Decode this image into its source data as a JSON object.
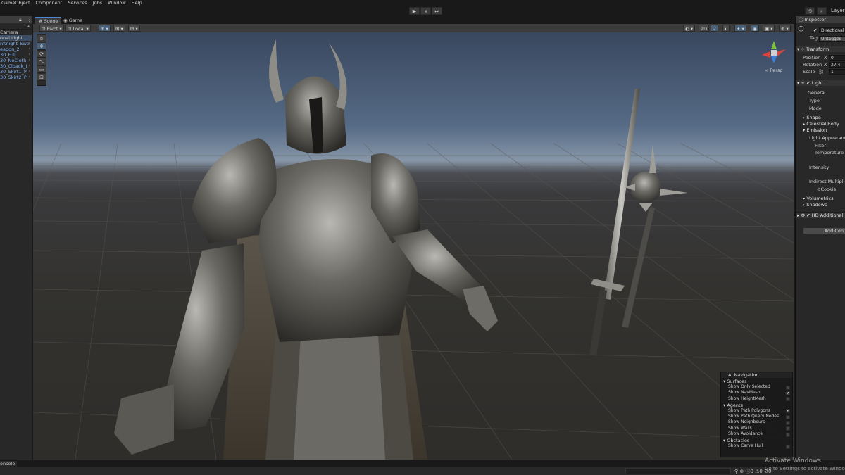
{
  "menu": [
    "GameObject",
    "Component",
    "Services",
    "Jobs",
    "Window",
    "Help"
  ],
  "toolbar": {
    "play": "▶",
    "pause": "⏸",
    "step": "⏭",
    "layers": "Layers"
  },
  "hierarchy": {
    "items": [
      {
        "label": "Camera",
        "blue": false,
        "selected": false
      },
      {
        "label": "onal Light",
        "blue": false,
        "selected": true
      },
      {
        "label": "nKnight_Swo",
        "blue": true,
        "selected": false
      },
      {
        "label": "eapon_2",
        "blue": true,
        "selected": false
      },
      {
        "label": "30_Full",
        "blue": true,
        "selected": false
      },
      {
        "label": "30_NoCloth",
        "blue": true,
        "selected": false
      },
      {
        "label": "30_Cloack_I",
        "blue": true,
        "selected": false
      },
      {
        "label": "30_Skirt1_P",
        "blue": true,
        "selected": false
      },
      {
        "label": "30_Skirt2_P",
        "blue": true,
        "selected": false
      }
    ]
  },
  "scene": {
    "tabs": [
      {
        "label": "Scene",
        "icon": "#"
      },
      {
        "label": "Game",
        "icon": "◉"
      }
    ],
    "pivot": "Pivot",
    "local": "Local",
    "persp": "< Persp"
  },
  "ai_navigation": {
    "title": "AI Navigation",
    "sections": [
      {
        "label": "Surfaces",
        "items": [
          {
            "label": "Show Only Selected",
            "checked": false
          },
          {
            "label": "Show NavMesh",
            "checked": true
          },
          {
            "label": "Show HeightMesh",
            "checked": false
          }
        ]
      },
      {
        "label": "Agents",
        "items": [
          {
            "label": "Show Path Polygons",
            "checked": true
          },
          {
            "label": "Show Path Query Nodes",
            "checked": false
          },
          {
            "label": "Show Neighbours",
            "checked": false
          },
          {
            "label": "Show Walls",
            "checked": false
          },
          {
            "label": "Show Avoidance",
            "checked": false
          }
        ]
      },
      {
        "label": "Obstacles",
        "items": [
          {
            "label": "Show Carve Hull",
            "checked": false
          }
        ]
      }
    ]
  },
  "inspector": {
    "tab": "Inspector",
    "object_name": "Directional",
    "tag_label": "Tag",
    "tag_value": "Untagged",
    "transform": {
      "title": "Transform",
      "position": "Position",
      "rotation": "Rotation",
      "scale": "Scale",
      "pos_x_label": "X",
      "pos_x": "0",
      "rot_x_label": "X",
      "rot_x": "27.4",
      "scale_x": "1"
    },
    "light": {
      "title": "Light",
      "general": "General",
      "type": "Type",
      "mode": "Mode",
      "shape": "Shape",
      "celestial": "Celestial Body",
      "emission": "Emission",
      "light_appearance": "Light Appearance",
      "filter": "Filter",
      "temperature": "Temperature",
      "intensity": "Intensity",
      "indirect": "Indirect Multiplier",
      "cookie": "Cookie",
      "volumetrics": "Volumetrics",
      "shadows": "Shadows"
    },
    "hd_additional": "HD Additional",
    "add_component": "Add Con"
  },
  "console": {
    "tab": "onsole"
  },
  "watermark": {
    "title": "Activate Windows",
    "subtitle": "Go to Settings to activate Windo"
  }
}
